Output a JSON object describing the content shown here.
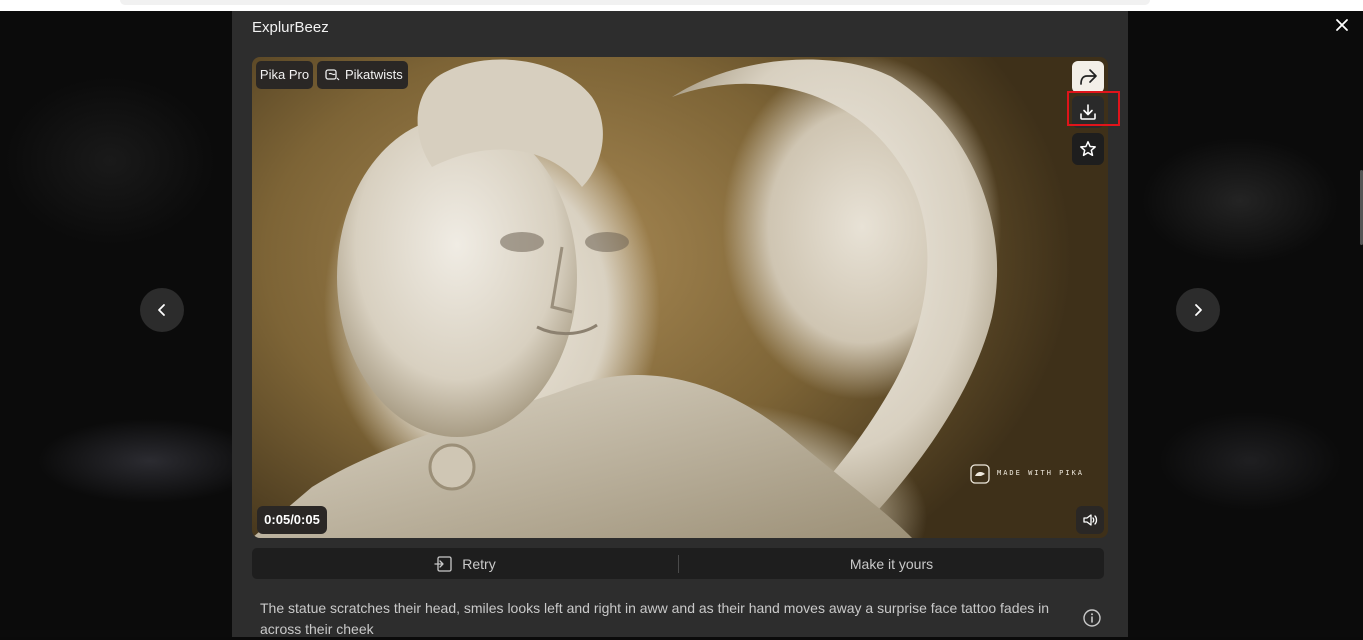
{
  "modal": {
    "title": "ExplurBeez"
  },
  "video": {
    "tags": [
      "Pika Pro",
      "Pikatwists"
    ],
    "time": "0:05/0:05",
    "watermark": "MADE WITH PIKA"
  },
  "actions": {
    "retry": "Retry",
    "make_it_yours": "Make it yours"
  },
  "prompt": "The statue scratches their head, smiles looks left and right in aww and as their hand moves away a surprise face tattoo fades in across their cheek",
  "icons": {
    "close": "close-icon",
    "share": "share-icon",
    "download": "download-icon",
    "favorite": "star-icon",
    "volume": "volume-icon",
    "prev": "chevron-left-icon",
    "next": "chevron-right-icon",
    "info": "info-icon"
  },
  "colors": {
    "highlight": "#e0141b",
    "modal_bg": "#2d2d2d",
    "action_bar_bg": "#1e1e1e"
  }
}
